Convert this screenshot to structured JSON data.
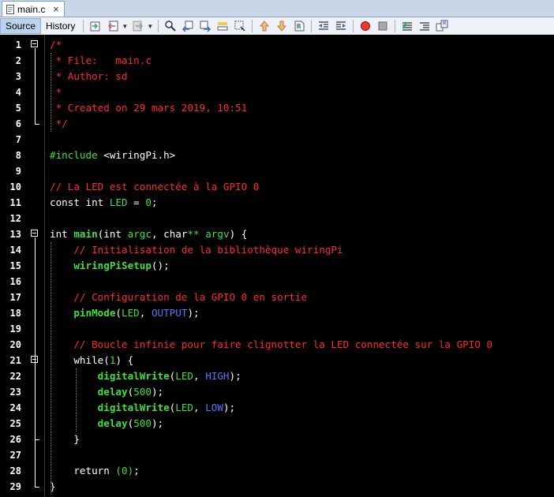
{
  "tab": {
    "label": "main.c",
    "close": "×"
  },
  "toolbar": {
    "source_label": "Source",
    "history_label": "History"
  },
  "lines": [
    {
      "n": "1",
      "code": [
        {
          "c": "cmt",
          "t": "/*"
        }
      ]
    },
    {
      "n": "2",
      "code": [
        {
          "c": "cmt",
          "t": " * File:   main.c"
        }
      ]
    },
    {
      "n": "3",
      "code": [
        {
          "c": "cmt",
          "t": " * Author: sd"
        }
      ]
    },
    {
      "n": "4",
      "code": [
        {
          "c": "cmt",
          "t": " *"
        }
      ]
    },
    {
      "n": "5",
      "code": [
        {
          "c": "cmt",
          "t": " * Created on 29 mars 2019, 10:51"
        }
      ]
    },
    {
      "n": "6",
      "code": [
        {
          "c": "cmt",
          "t": " */"
        }
      ]
    },
    {
      "n": "7",
      "code": []
    },
    {
      "n": "8",
      "code": [
        {
          "c": "pp",
          "t": "#include "
        },
        {
          "c": "kw",
          "t": "<"
        },
        {
          "c": "kw",
          "t": "wiringPi.h"
        },
        {
          "c": "kw",
          "t": ">"
        }
      ]
    },
    {
      "n": "9",
      "code": []
    },
    {
      "n": "10",
      "code": [
        {
          "c": "cmt",
          "t": "// La LED est connectée à la GPIO 0"
        }
      ]
    },
    {
      "n": "11",
      "code": [
        {
          "c": "kw",
          "t": "const int "
        },
        {
          "c": "id",
          "t": "LED"
        },
        {
          "c": "kw",
          "t": " = "
        },
        {
          "c": "id",
          "t": "0"
        },
        {
          "c": "kw",
          "t": ";"
        }
      ]
    },
    {
      "n": "12",
      "code": []
    },
    {
      "n": "13",
      "code": [
        {
          "c": "kw",
          "t": "int "
        },
        {
          "c": "fn",
          "t": "main"
        },
        {
          "c": "kw",
          "t": "(int "
        },
        {
          "c": "id",
          "t": "argc"
        },
        {
          "c": "kw",
          "t": ", char"
        },
        {
          "c": "id",
          "t": "**"
        },
        {
          "c": "kw",
          "t": " "
        },
        {
          "c": "id",
          "t": "argv"
        },
        {
          "c": "kw",
          "t": ") {"
        }
      ]
    },
    {
      "n": "14",
      "code": [
        {
          "c": "kw",
          "t": "    "
        },
        {
          "c": "cmt",
          "t": "// Initialisation de la bibliothèque wiringPi"
        }
      ]
    },
    {
      "n": "15",
      "code": [
        {
          "c": "kw",
          "t": "    "
        },
        {
          "c": "fn",
          "t": "wiringPiSetup"
        },
        {
          "c": "kw",
          "t": "();"
        }
      ]
    },
    {
      "n": "16",
      "code": []
    },
    {
      "n": "17",
      "code": [
        {
          "c": "kw",
          "t": "    "
        },
        {
          "c": "cmt",
          "t": "// Configuration de la GPIO 0 en sortie"
        }
      ]
    },
    {
      "n": "18",
      "code": [
        {
          "c": "kw",
          "t": "    "
        },
        {
          "c": "fn",
          "t": "pinMode"
        },
        {
          "c": "kw",
          "t": "("
        },
        {
          "c": "id",
          "t": "LED"
        },
        {
          "c": "kw",
          "t": ", "
        },
        {
          "c": "cst",
          "t": "OUTPUT"
        },
        {
          "c": "kw",
          "t": ");"
        }
      ]
    },
    {
      "n": "19",
      "code": []
    },
    {
      "n": "20",
      "code": [
        {
          "c": "kw",
          "t": "    "
        },
        {
          "c": "cmt",
          "t": "// Boucle infinie pour faire clignotter la LED connectée sur la GPIO 0"
        }
      ]
    },
    {
      "n": "21",
      "code": [
        {
          "c": "kw",
          "t": "    "
        },
        {
          "c": "kw",
          "t": "while("
        },
        {
          "c": "id",
          "t": "1"
        },
        {
          "c": "kw",
          "t": ") {"
        }
      ]
    },
    {
      "n": "22",
      "code": [
        {
          "c": "kw",
          "t": "        "
        },
        {
          "c": "fn",
          "t": "digitalWrite"
        },
        {
          "c": "kw",
          "t": "("
        },
        {
          "c": "id",
          "t": "LED"
        },
        {
          "c": "kw",
          "t": ", "
        },
        {
          "c": "cst",
          "t": "HIGH"
        },
        {
          "c": "kw",
          "t": ");"
        }
      ]
    },
    {
      "n": "23",
      "code": [
        {
          "c": "kw",
          "t": "        "
        },
        {
          "c": "fn",
          "t": "delay"
        },
        {
          "c": "kw",
          "t": "("
        },
        {
          "c": "id",
          "t": "500"
        },
        {
          "c": "kw",
          "t": ");"
        }
      ]
    },
    {
      "n": "24",
      "code": [
        {
          "c": "kw",
          "t": "        "
        },
        {
          "c": "fn",
          "t": "digitalWrite"
        },
        {
          "c": "kw",
          "t": "("
        },
        {
          "c": "id",
          "t": "LED"
        },
        {
          "c": "kw",
          "t": ", "
        },
        {
          "c": "cst",
          "t": "LOW"
        },
        {
          "c": "kw",
          "t": ");"
        }
      ]
    },
    {
      "n": "25",
      "code": [
        {
          "c": "kw",
          "t": "        "
        },
        {
          "c": "fn",
          "t": "delay"
        },
        {
          "c": "kw",
          "t": "("
        },
        {
          "c": "id",
          "t": "500"
        },
        {
          "c": "kw",
          "t": ");"
        }
      ]
    },
    {
      "n": "26",
      "code": [
        {
          "c": "kw",
          "t": "    }"
        }
      ]
    },
    {
      "n": "27",
      "code": []
    },
    {
      "n": "28",
      "code": [
        {
          "c": "kw",
          "t": "    return "
        },
        {
          "c": "id",
          "t": "(0)"
        },
        {
          "c": "kw",
          "t": ";"
        }
      ]
    },
    {
      "n": "29",
      "code": [
        {
          "c": "kw",
          "t": "}"
        }
      ]
    }
  ]
}
